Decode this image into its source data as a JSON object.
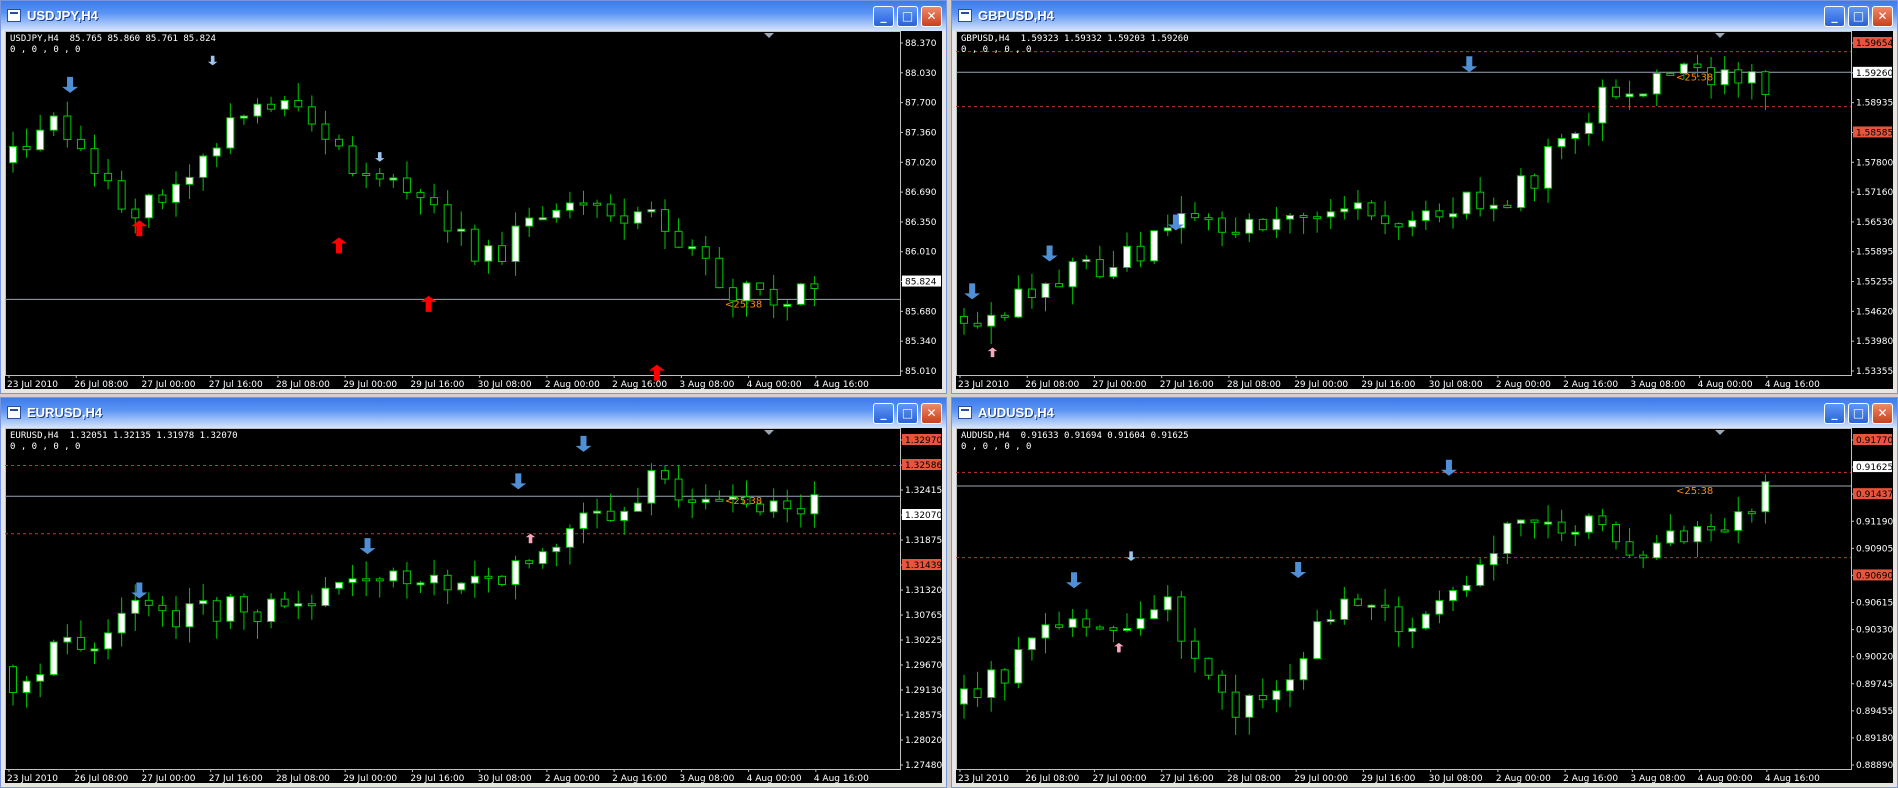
{
  "colors": {
    "bull": "#ffffff",
    "bear": "#000000",
    "wick": "#00c800",
    "bg": "#000000",
    "grid": "#000000",
    "priceLine": "#9aa7b5",
    "dashed": "#c0392b",
    "blueArrow": "#4f8fd6",
    "lightBlueArrow": "#9ec3ee",
    "redArrow": "#ff0000",
    "pinkArrow": "#f7a8b8",
    "timer": "#ff8c00"
  },
  "windows": [
    {
      "title": "USDJPY,H4",
      "symbol": "USDJPY",
      "info": "USDJPY,H4  85.765 85.860 85.761 85.824",
      "info2": "0 , 0 , 0 , 0",
      "price_labels": [
        "88.370",
        "88.030",
        "87.700",
        "87.360",
        "87.020",
        "86.690",
        "86.350",
        "86.010",
        "85.824",
        "85.680",
        "85.340",
        "85.010"
      ],
      "current_price": "85.824",
      "time_labels": [
        "23 Jul 2010",
        "26 Jul 08:00",
        "27 Jul 00:00",
        "27 Jul 16:00",
        "28 Jul 08:00",
        "29 Jul 00:00",
        "29 Jul 16:00",
        "30 Jul 08:00",
        "2 Aug 00:00",
        "2 Aug 16:00",
        "3 Aug 08:00",
        "4 Aug 00:00",
        "4 Aug 16:00"
      ],
      "timer": "<25:38",
      "candle_label": "candlestick"
    },
    {
      "title": "GBPUSD,H4",
      "symbol": "GBPUSD",
      "info": "GBPUSD,H4  1.59323 1.59332 1.59203 1.59260",
      "info2": "0 , 0 , 0 , 0",
      "price_labels": [
        "1.59654",
        "1.59260",
        "1.58935",
        "1.58585",
        "1.57800",
        "1.57160",
        "1.56530",
        "1.55895",
        "1.55255",
        "1.54620",
        "1.53980",
        "1.53355"
      ],
      "current_price": "1.59260",
      "time_labels": [
        "23 Jul 2010",
        "26 Jul 08:00",
        "27 Jul 00:00",
        "27 Jul 16:00",
        "28 Jul 08:00",
        "29 Jul 00:00",
        "29 Jul 16:00",
        "30 Jul 08:00",
        "2 Aug 00:00",
        "2 Aug 16:00",
        "3 Aug 08:00",
        "4 Aug 00:00",
        "4 Aug 16:00"
      ],
      "timer": "<25:38"
    },
    {
      "title": "EURUSD,H4",
      "symbol": "EURUSD",
      "info": "EURUSD,H4  1.32051 1.32135 1.31978 1.32070",
      "info2": "0 , 0 , 0 , 0",
      "price_labels": [
        "1.32970",
        "1.32586",
        "1.32415",
        "1.32070",
        "1.31875",
        "1.31439",
        "1.31320",
        "1.30765",
        "1.30225",
        "1.29670",
        "1.29130",
        "1.28575",
        "1.28020",
        "1.27480"
      ],
      "current_price": "1.32070",
      "time_labels": [
        "23 Jul 2010",
        "26 Jul 08:00",
        "27 Jul 00:00",
        "27 Jul 16:00",
        "28 Jul 08:00",
        "29 Jul 00:00",
        "29 Jul 16:00",
        "30 Jul 08:00",
        "2 Aug 00:00",
        "2 Aug 16:00",
        "3 Aug 08:00",
        "4 Aug 00:00",
        "4 Aug 16:00"
      ],
      "timer": "<25:38"
    },
    {
      "title": "AUDUSD,H4",
      "symbol": "AUDUSD",
      "info": "AUDUSD,H4  0.91633 0.91694 0.91604 0.91625",
      "info2": "0 , 0 , 0 , 0",
      "price_labels": [
        "0.91770",
        "0.91625",
        "0.91437",
        "0.91190",
        "0.90905",
        "0.90690",
        "0.90615",
        "0.90330",
        "0.90020",
        "0.89745",
        "0.89455",
        "0.89180",
        "0.88890"
      ],
      "current_price": "0.91625",
      "time_labels": [
        "23 Jul 2010",
        "26 Jul 08:00",
        "27 Jul 00:00",
        "27 Jul 16:00",
        "28 Jul 08:00",
        "29 Jul 00:00",
        "29 Jul 16:00",
        "30 Jul 08:00",
        "2 Aug 00:00",
        "2 Aug 16:00",
        "3 Aug 08:00",
        "4 Aug 00:00",
        "4 Aug 16:00"
      ],
      "timer": "<25:38"
    }
  ],
  "buttons": {
    "minimize": "_",
    "maximize": "□",
    "close": "✕"
  }
}
